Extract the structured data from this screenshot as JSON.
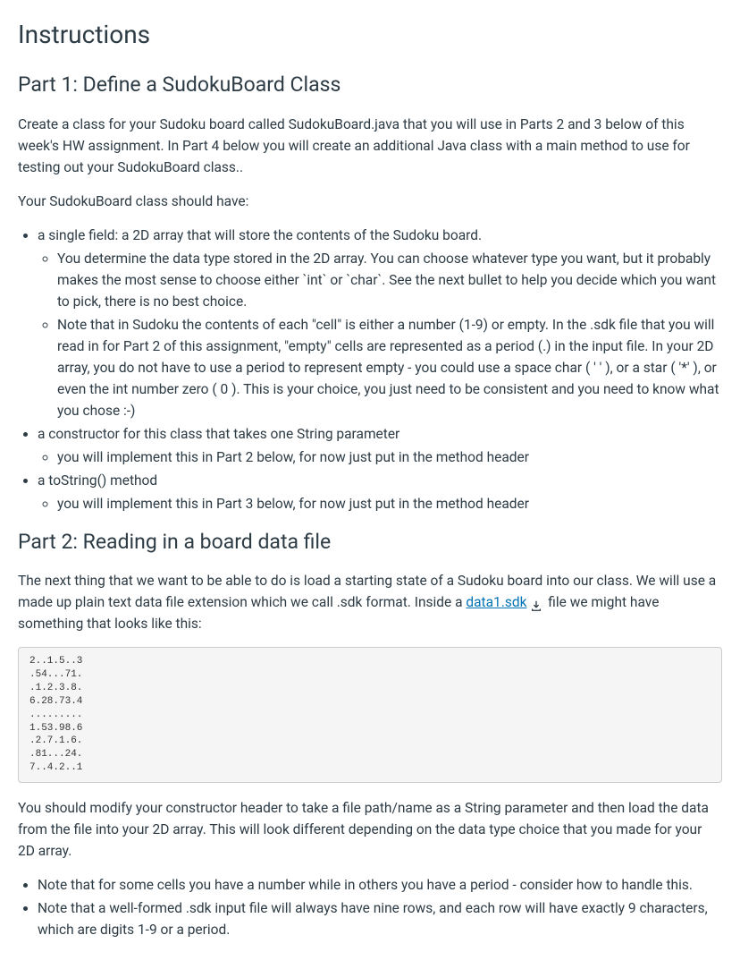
{
  "heading_instructions": "Instructions",
  "part1": {
    "heading": "Part 1: Define a SudokuBoard Class",
    "paragraph1": "Create a class for your Sudoku board called SudokuBoard.java that you will use in Parts 2 and 3 below of this week's HW assignment. In Part 4 below you will create an additional Java class with a main method to use for testing out your SudokuBoard class..",
    "paragraph2": "Your SudokuBoard class should have:",
    "items": {
      "field_text": "a single field: a 2D array that will store the contents of the Sudoku board.",
      "field_sub1": "You determine the data type stored in the 2D array. You can choose whatever type you want, but it probably makes the most sense to choose either `int` or `char`. See the next bullet to help you decide which you want to pick, there is no best choice.",
      "field_sub2": "Note that in Sudoku the contents of each \"cell\" is either a number (1-9) or empty. In the .sdk file that you will read in for Part 2 of this assignment, \"empty\" cells are represented as a period (.) in the input file. In your 2D array, you do not have to use a period to represent empty - you could use a space char ( ' ' ), or a star ( '*' ), or even the int number zero ( 0 ). This is your choice, you just need to be consistent and you need to know what you chose :-)",
      "constructor_text": "a constructor for this class that takes one String parameter",
      "constructor_sub1": "you will implement this in Part 2 below, for now just put in the method header",
      "tostring_text": "a toString() method",
      "tostring_sub1": "you will implement this in Part 3 below, for now just put in the method header"
    }
  },
  "part2": {
    "heading": "Part 2: Reading in a board data file",
    "paragraph1_pre": "The next thing that we want to be able to do is load a starting state of a Sudoku board into our class. We will use a made up plain text data file extension which we call .sdk format. Inside a ",
    "link_text": "data1.sdk",
    "paragraph1_post": " file we might have something that looks like this:",
    "code_block": "2..1.5..3\n.54...71.\n.1.2.3.8.\n6.28.73.4\n.........\n1.53.98.6\n.2.7.1.6.\n.81...24.\n7..4.2..1",
    "paragraph2": "You should modify your constructor header to take a file path/name as a String parameter and then load the data from the file into your 2D array. This will look different depending on the data type choice that you made for your 2D array.",
    "notes": {
      "note1": "Note that for some cells you have a number while in others you have a period - consider how to handle this.",
      "note2": "Note that a well-formed .sdk input file will always have nine rows, and each row will have exactly 9 characters, which are digits 1-9 or a period."
    }
  }
}
